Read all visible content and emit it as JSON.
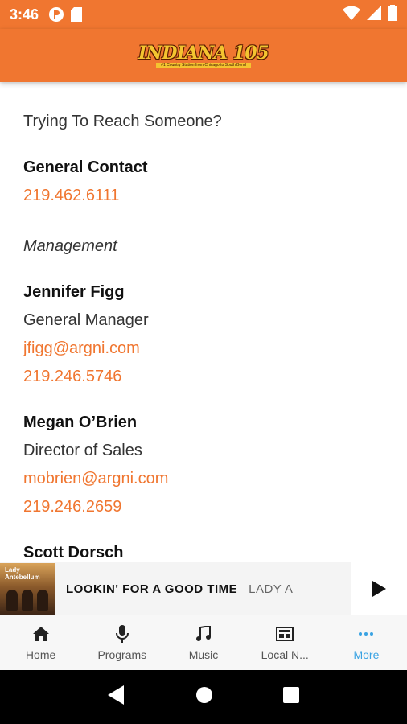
{
  "status_bar": {
    "time": "3:46"
  },
  "app_bar": {
    "logo_text": "INDIANA 105",
    "logo_tagline": "#1 Country Station from Chicago to South Bend"
  },
  "content": {
    "intro": "Trying To Reach Someone?",
    "general": {
      "label": "General Contact",
      "phone": "219.462.6111"
    },
    "section_management": "Management",
    "contacts": [
      {
        "name": "Jennifer Figg",
        "title": "General Manager",
        "email": "jfigg@argni.com",
        "phone": "219.246.5746"
      },
      {
        "name": "Megan O’Brien",
        "title": "Director of Sales",
        "email": "mobrien@argni.com",
        "phone": "219.246.2659"
      },
      {
        "name": "Scott Dorsch"
      }
    ]
  },
  "now_playing": {
    "title": "LOOKIN' FOR A GOOD TIME",
    "artist": "LADY A",
    "art_text": "Lady Antebellum"
  },
  "tabs": [
    {
      "label": "Home",
      "icon": "home-icon"
    },
    {
      "label": "Programs",
      "icon": "microphone-icon"
    },
    {
      "label": "Music",
      "icon": "music-note-icon"
    },
    {
      "label": "Local N...",
      "icon": "news-icon"
    },
    {
      "label": "More",
      "icon": "more-dots-icon"
    }
  ],
  "colors": {
    "accent": "#f07630",
    "active_tab": "#3aa3e3"
  }
}
